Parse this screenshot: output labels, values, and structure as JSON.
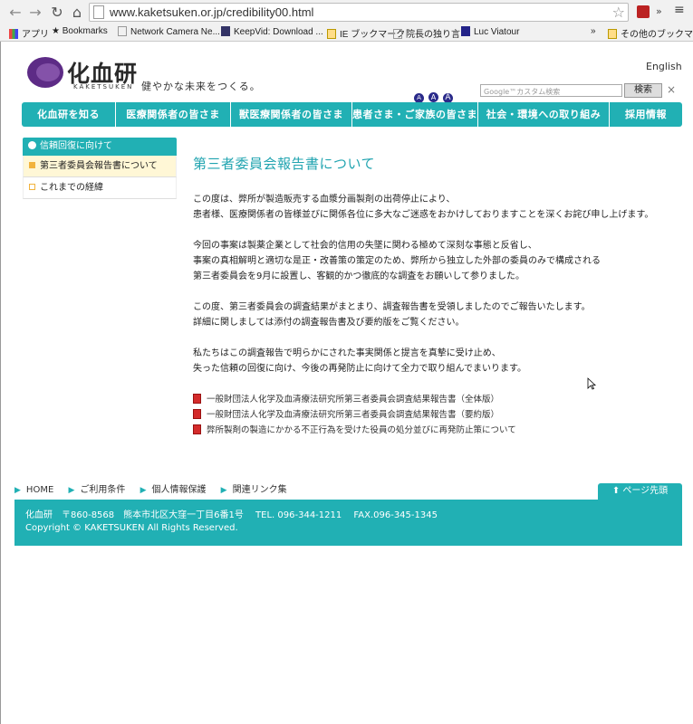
{
  "browser": {
    "url": "www.kaketsuken.or.jp/credibility00.html",
    "bookmarks": [
      {
        "label": "アプリ"
      },
      {
        "label": "Bookmarks"
      },
      {
        "label": "Network Camera Ne..."
      },
      {
        "label": "KeepVid: Download ..."
      },
      {
        "label": "IE ブックマーク"
      },
      {
        "label": "院長の独り言"
      },
      {
        "label": "Luc Viatour"
      },
      {
        "label": "»"
      },
      {
        "label": "その他のブックマーク"
      }
    ]
  },
  "header": {
    "logo_text": "化血研",
    "logo_sub": "KAKETSUKEN",
    "tagline": "健やかな未来をつくる。",
    "english_link": "English",
    "font_size_labels": [
      "A",
      "A",
      "A"
    ],
    "search_placeholder": "Google™カスタム検索",
    "search_button": "検索",
    "close": "×"
  },
  "gnav": [
    {
      "label": "化血研を知る"
    },
    {
      "label": "医療関係者の皆さま"
    },
    {
      "label": "獣医療関係者の皆さま"
    },
    {
      "label": "患者さま・ご家族の皆さま"
    },
    {
      "label": "社会・環境への取り組み"
    },
    {
      "label": "採用情報"
    }
  ],
  "sidebar": {
    "heading": "信頼回復に向けて",
    "items": [
      {
        "label": "第三者委員会報告書について",
        "active": true
      },
      {
        "label": "これまでの経緯",
        "active": false
      }
    ]
  },
  "main": {
    "title": "第三者委員会報告書について",
    "paragraphs": [
      {
        "lines": [
          "この度は、弊所が製造販売する血漿分画製剤の出荷停止により、",
          "患者様、医療関係者の皆様並びに関係各位に多大なご迷惑をおかけしておりますことを深くお詫び申し上げます。"
        ]
      },
      {
        "lines": [
          "今回の事案は製薬企業として社会的信用の失墜に関わる極めて深刻な事態と反省し、",
          "事案の真相解明と適切な是正・改善策の策定のため、弊所から独立した外部の委員のみで構成される",
          "第三者委員会を9月に設置し、客観的かつ徹底的な調査をお願いして参りました。"
        ]
      },
      {
        "lines": [
          "この度、第三者委員会の調査結果がまとまり、調査報告書を受領しましたのでご報告いたします。",
          "詳細に関しましては添付の調査報告書及び要約版をご覧ください。"
        ]
      },
      {
        "lines": [
          "私たちはこの調査報告で明らかにされた事実関係と提言を真摯に受け止め、",
          "失った信頼の回復に向け、今後の再発防止に向けて全力で取り組んでまいります。"
        ]
      }
    ],
    "pdf_links": [
      {
        "label": "一般財団法人化学及血清療法研究所第三者委員会調査結果報告書（全体版）"
      },
      {
        "label": "一般財団法人化学及血清療法研究所第三者委員会調査結果報告書（要約版）"
      },
      {
        "label": "弊所製剤の製造にかかる不正行為を受けた役員の処分並びに再発防止策について"
      }
    ]
  },
  "footer": {
    "nav": [
      {
        "label": "HOME"
      },
      {
        "label": "ご利用条件"
      },
      {
        "label": "個人情報保護"
      },
      {
        "label": "関連リンク集"
      }
    ],
    "page_top": "ページ先頭",
    "address": "化血研　〒860-8568　熊本市北区大窪一丁目6番1号　 TEL. 096-344-1211　 FAX.096-345-1345",
    "copyright": "Copyright © KAKETSUKEN All Rights Reserved."
  },
  "colors": {
    "accent": "#21b0b4",
    "title": "#21a4b0",
    "logo": "#5d2b86",
    "sidebar_active_bg": "#fff7d6",
    "bullet": "#f2b33d"
  }
}
